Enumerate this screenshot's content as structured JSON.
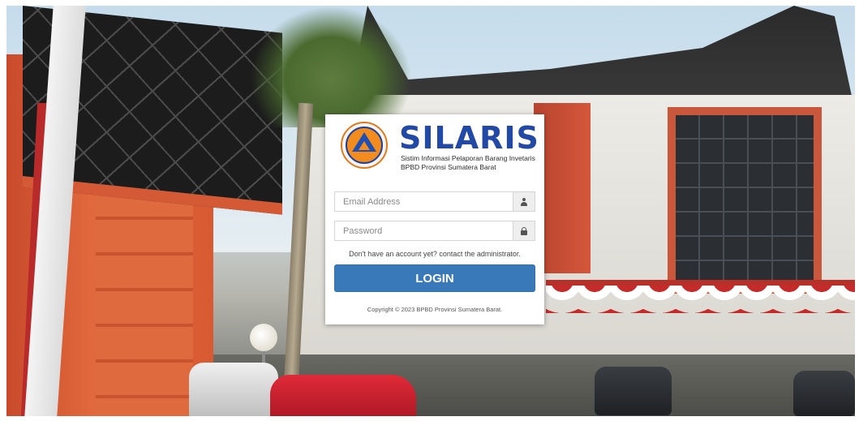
{
  "brand": {
    "name": "SILARIS",
    "subtitle_line1": "Sistim Informasi Pelaporan Barang Invetaris",
    "subtitle_line2": "BPBD Provinsi Sumatera Barat",
    "logo_icon": "bpbd-emblem"
  },
  "form": {
    "email_placeholder": "Email Address",
    "email_value": "",
    "email_icon": "user-icon",
    "password_placeholder": "Password",
    "password_value": "",
    "password_icon": "lock-icon",
    "help_text": "Don't have an account yet? contact the administrator.",
    "login_label": "LOGIN"
  },
  "footer": {
    "copyright": "Copyright © 2023 BPBD Provinsi Sumatera Barat."
  },
  "colors": {
    "brand_blue": "#2349a6",
    "button_blue": "#3a79b9",
    "logo_orange": "#f28c1f"
  }
}
